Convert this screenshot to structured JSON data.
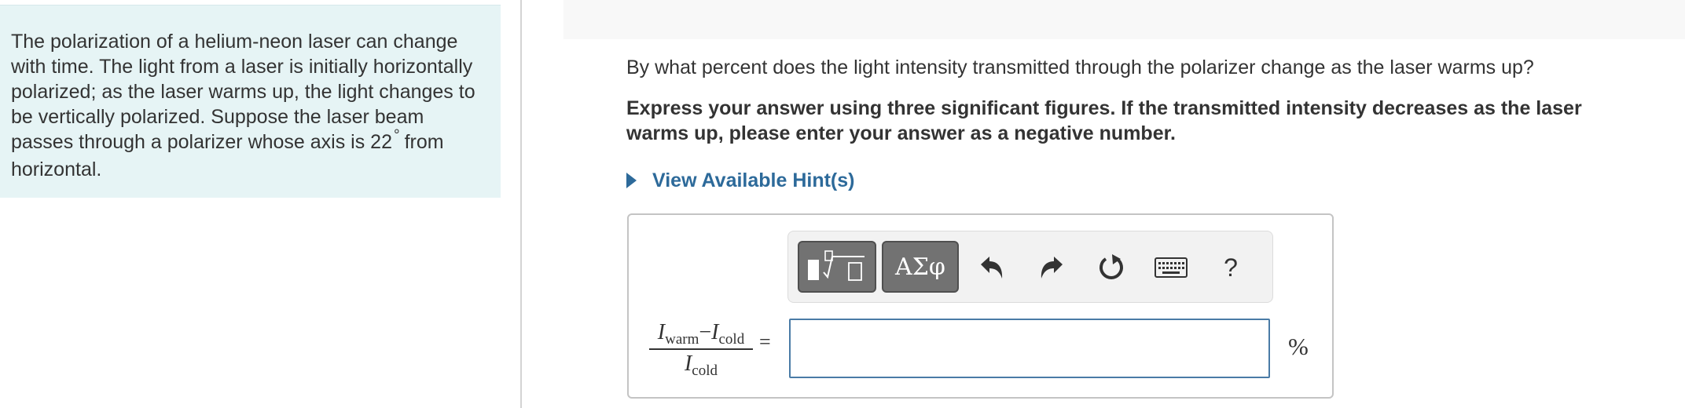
{
  "problem": {
    "text_before": "The polarization of a helium-neon laser can change with time. The light from a laser is initially horizontally polarized; as the laser warms up, the light changes to be vertically polarized. Suppose the laser beam passes through a polarizer whose axis is 22",
    "degree_symbol": "°",
    "text_after": "from horizontal."
  },
  "question": {
    "prompt": "By what percent does the light intensity transmitted through the polarizer change as the laser warms up?",
    "instruction": "Express your answer using three significant figures.  If the transmitted intensity decreases as the laser warms up, please enter your answer as a negative number."
  },
  "hint": {
    "label": "View Available Hint(s)"
  },
  "toolbar": {
    "templates_icon": "templates-icon",
    "symbols_label": "ΑΣφ",
    "undo_icon": "undo-icon",
    "redo_icon": "redo-icon",
    "reset_icon": "reset-icon",
    "keyboard_icon": "keyboard-icon",
    "help_label": "?"
  },
  "formula": {
    "var": "I",
    "warm_sub": "warm",
    "minus": "−",
    "cold_sub": "cold",
    "equals": "="
  },
  "answer": {
    "value": "",
    "unit": "%"
  },
  "colors": {
    "problem_bg": "#e6f4f5",
    "hint_blue": "#2d6a9a",
    "input_border": "#4a7ba6",
    "toolbar_button": "#727272"
  }
}
